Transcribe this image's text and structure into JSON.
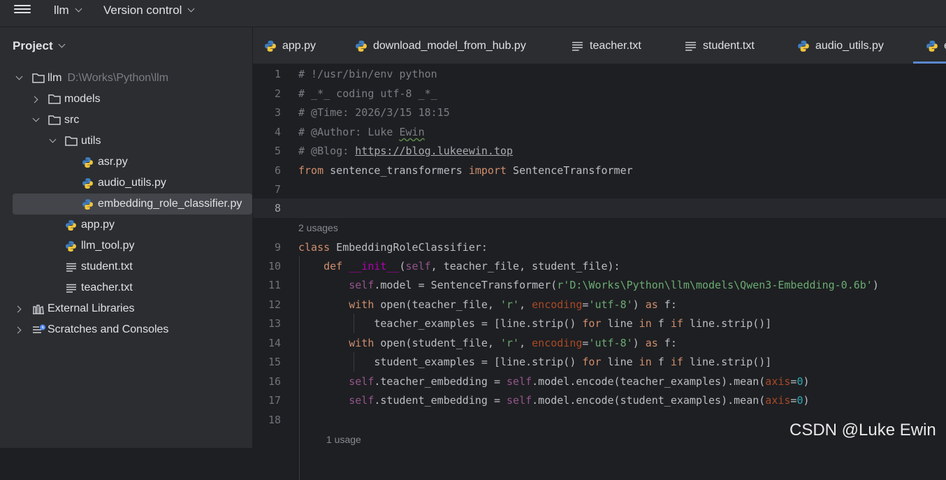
{
  "topbar": {
    "project_menu": "llm",
    "vcs_menu": "Version control"
  },
  "sidebar": {
    "title": "Project",
    "root": {
      "name": "llm",
      "path": "D:\\Works\\Python\\llm"
    },
    "items": [
      {
        "label": "models"
      },
      {
        "label": "src"
      },
      {
        "label": "utils"
      },
      {
        "label": "asr.py"
      },
      {
        "label": "audio_utils.py"
      },
      {
        "label": "embedding_role_classifier.py"
      },
      {
        "label": "app.py"
      },
      {
        "label": "llm_tool.py"
      },
      {
        "label": "student.txt"
      },
      {
        "label": "teacher.txt"
      },
      {
        "label": "External Libraries"
      },
      {
        "label": "Scratches and Consoles"
      }
    ]
  },
  "tabs": [
    {
      "label": "app.py",
      "icon": "python-icon"
    },
    {
      "label": "download_model_from_hub.py",
      "icon": "python-icon"
    },
    {
      "label": "teacher.txt",
      "icon": "text-file-icon"
    },
    {
      "label": "student.txt",
      "icon": "text-file-icon"
    },
    {
      "label": "audio_utils.py",
      "icon": "python-icon"
    },
    {
      "label": "e",
      "icon": "python-icon"
    }
  ],
  "editor": {
    "usages": [
      "2 usages",
      "1 usage"
    ],
    "line_numbers": [
      "1",
      "2",
      "3",
      "4",
      "5",
      "6",
      "7",
      "8",
      "9",
      "10",
      "11",
      "12",
      "13",
      "14",
      "15",
      "16",
      "17",
      "18"
    ],
    "tokens": {
      "l1": "# !/usr/bin/env python",
      "l2": "# _*_ coding utf-8 _*_",
      "l3": "# @Time: 2026/3/15 18:15",
      "l4a": "# @Author: Luke ",
      "l4b": "Ewin",
      "l5a": "# @Blog: ",
      "l5b": "https://blog.lukeewin.top",
      "from": "from",
      "module": " sentence_transformers ",
      "import": "import",
      "st_name": " SentenceTransformer",
      "class": "class",
      "class_name": " EmbeddingRoleClassifier:",
      "def": "def",
      "init": "__init__",
      "self": "self",
      "open": "open",
      "with": "with",
      "as": " as",
      "for": "for",
      "in": " in ",
      "if": "if",
      "encoding": "encoding",
      "axis": "axis",
      "zero": "0",
      "r_mode": "'r'",
      "utf8": "'utf-8'",
      "model_path": "r'D:\\Works\\Python\\llm\\models\\Qwen3-Embedding-0.6b'",
      "l10_params": ", teacher_file, student_file):",
      "l11_mid": ".model = SentenceTransformer(",
      "l11_end": ")",
      "paren_open": "(",
      "teacher_file_arg": "teacher_file, ",
      "student_file_arg": "student_file, ",
      "comma": ", ",
      "eq": "=",
      "close_as": ")",
      "colon": " f:",
      "l13_start": "teacher_examples = [line.strip() ",
      "l15_start": "student_examples = [line.strip() ",
      "line_word": " line",
      "f_word": "f ",
      "strip_end": " line.strip()]",
      "l16_mid": ".teacher_embedding = ",
      "l17_mid": ".student_embedding = ",
      "l16_tail_teacher": ".model.encode(teacher_examples).mean(",
      "l17_tail_student": ".model.encode(student_examples).mean(",
      "close_paren": ")"
    }
  },
  "watermark": "CSDN @Luke Ewin"
}
